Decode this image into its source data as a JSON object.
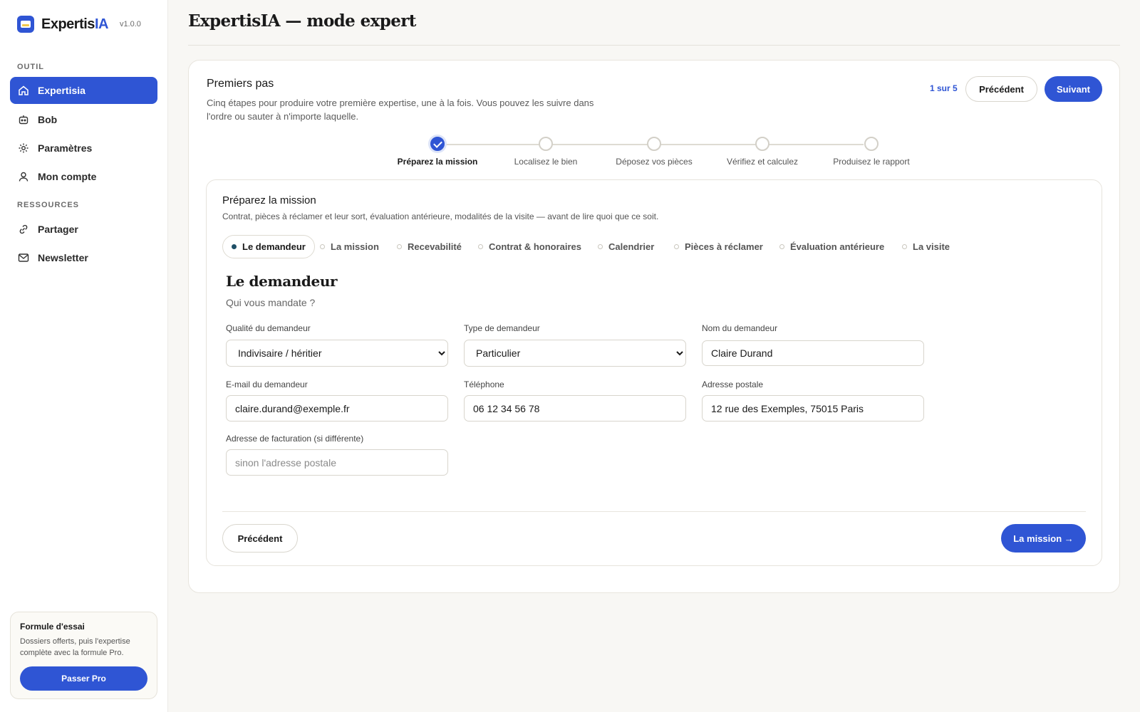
{
  "brand": {
    "name_main": "Expertis",
    "name_accent": "IA",
    "version": "v1.0.0"
  },
  "sidebar": {
    "section_tool": "OUTIL",
    "section_resources": "RESSOURCES",
    "items": [
      {
        "label": "Expertisia",
        "icon": "home-icon"
      },
      {
        "label": "Bob",
        "icon": "robot-icon"
      },
      {
        "label": "Paramètres",
        "icon": "gear-icon"
      },
      {
        "label": "Mon compte",
        "icon": "user-icon"
      },
      {
        "label": "Partager",
        "icon": "link-icon"
      },
      {
        "label": "Newsletter",
        "icon": "mail-icon"
      }
    ],
    "trial": {
      "title": "Formule d'essai",
      "text": "Dossiers offerts, puis l'expertise complète avec la formule Pro.",
      "button": "Passer Pro"
    }
  },
  "page": {
    "title": "ExpertisIA — mode expert"
  },
  "onboarding": {
    "title": "Premiers pas",
    "description": "Cinq étapes pour produire votre première expertise, une à la fois. Vous pouvez les suivre dans l'ordre ou sauter à n'importe laquelle.",
    "step_count": "1 sur 5",
    "prev": "Précédent",
    "next": "Suivant",
    "steps": [
      "Préparez la mission",
      "Localisez le bien",
      "Déposez vos pièces",
      "Vérifiez et calculez",
      "Produisez le rapport"
    ]
  },
  "mission": {
    "title": "Préparez la mission",
    "description": "Contrat, pièces à réclamer et leur sort, évaluation antérieure, modalités de la visite — avant de lire quoi que ce soit.",
    "tabs": [
      "Le demandeur",
      "La mission",
      "Recevabilité",
      "Contrat & honoraires",
      "Calendrier",
      "Pièces à réclamer",
      "Évaluation antérieure",
      "La visite"
    ]
  },
  "form": {
    "heading": "Le demandeur",
    "subheading": "Qui vous mandate ?",
    "quality_label": "Qualité du demandeur",
    "quality_value": "Indivisaire / héritier",
    "type_label": "Type de demandeur",
    "type_value": "Particulier",
    "name_label": "Nom du demandeur",
    "name_value": "Claire Durand",
    "email_label": "E-mail du demandeur",
    "email_value": "claire.durand@exemple.fr",
    "phone_label": "Téléphone",
    "phone_value": "06 12 34 56 78",
    "address_label": "Adresse postale",
    "address_value": "12 rue des Exemples, 75015 Paris",
    "billing_label": "Adresse de facturation (si différente)",
    "billing_placeholder": "sinon l'adresse postale",
    "prev": "Précédent",
    "next": "La mission →"
  },
  "colors": {
    "accent": "#2f55d4",
    "background": "#f8f7f4"
  }
}
